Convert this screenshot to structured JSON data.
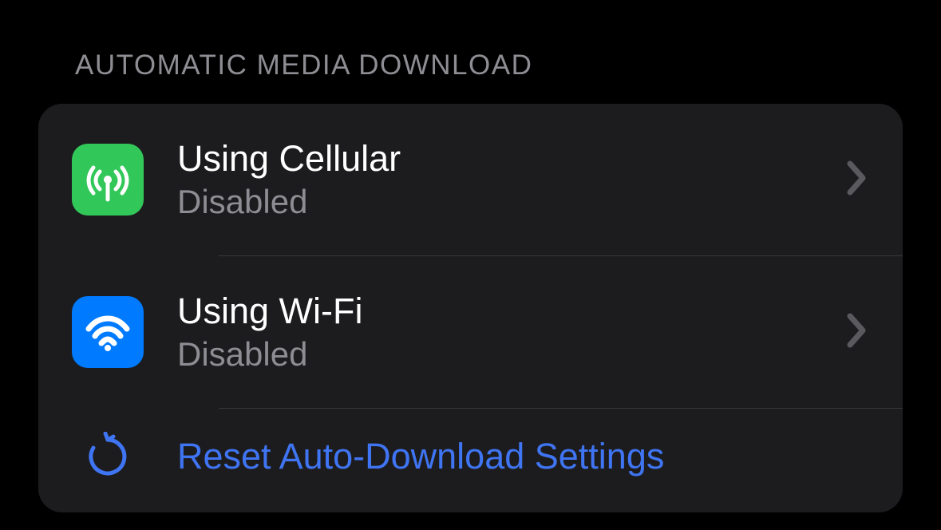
{
  "section": {
    "header": "AUTOMATIC MEDIA DOWNLOAD",
    "items": [
      {
        "title": "Using Cellular",
        "subtitle": "Disabled",
        "icon": "cellular-antenna-icon",
        "iconColor": "#32c759"
      },
      {
        "title": "Using Wi-Fi",
        "subtitle": "Disabled",
        "icon": "wifi-icon",
        "iconColor": "#007aff"
      }
    ],
    "resetLabel": "Reset Auto-Download Settings"
  }
}
